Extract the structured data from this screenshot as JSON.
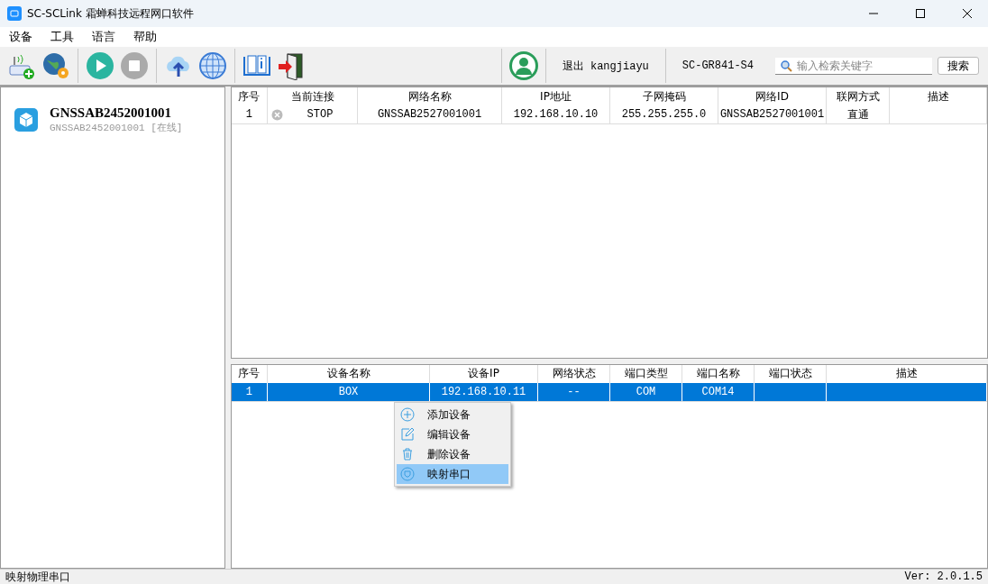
{
  "window": {
    "title": "SC-SCLink 霜蝉科技远程网口软件"
  },
  "menu": [
    "设备",
    "工具",
    "语言",
    "帮助"
  ],
  "toolbar": {
    "logout": "退出 kangjiayu",
    "model": "SC-GR841-S4",
    "search": {
      "placeholder": "输入检索关键字"
    },
    "search_button": "搜索"
  },
  "sidebar": {
    "items": [
      {
        "name": "GNSSAB2452001001",
        "detail": "GNSSAB2452001001 [在线]",
        "selected": false
      }
    ]
  },
  "connections": {
    "columns": [
      "序号",
      "当前连接",
      "网络名称",
      "IP地址",
      "子网掩码",
      "网络ID",
      "联网方式",
      "描述"
    ],
    "rows": [
      {
        "cells": [
          "1",
          "STOP",
          "GNSSAB2527001001",
          "192.168.10.10",
          "255.255.255.0",
          "GNSSAB2527001001",
          "直通",
          ""
        ],
        "selected": false
      }
    ]
  },
  "devices": {
    "columns": [
      "序号",
      "设备名称",
      "设备IP",
      "网络状态",
      "端口类型",
      "端口名称",
      "端口状态",
      "描述"
    ],
    "rows": [
      {
        "cells": [
          "1",
          "BOX",
          "192.168.10.11",
          "--",
          "COM",
          "COM14",
          "",
          ""
        ],
        "selected": true
      }
    ]
  },
  "context_menu": [
    {
      "label": "添加设备",
      "kind": "add",
      "selected": false
    },
    {
      "label": "编辑设备",
      "kind": "edit",
      "selected": false
    },
    {
      "label": "删除设备",
      "kind": "delete",
      "selected": false
    },
    {
      "label": "映射串口",
      "kind": "map",
      "selected": true
    }
  ],
  "status_bar": {
    "message": "映射物理串口",
    "version": "Ver: 2.0.1.5"
  }
}
